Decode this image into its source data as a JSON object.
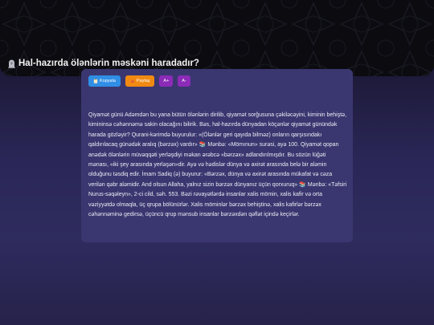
{
  "page": {
    "title": "Hal-hazırda ölənlərin məskəni haradadır?",
    "title_icon": "tombstone-icon"
  },
  "toolbar": {
    "copy_label": "Kopyala",
    "copy_icon": "clipboard-icon",
    "share_label": "Paylaş",
    "share_icon": "share-icon",
    "font_increase_label": "A+",
    "font_decrease_label": "A-"
  },
  "article": {
    "text": "Qiyamət günü Adəmdən bu yana bütün ölənlərin dirilib, qiyamət sorğusuna çəkiləcəyini, kiminin behiştə, kimininsə cəhənnəmə sakin olacağını bilirik. Bəs, hal-hazırda dünyadan köçənlər qiyamət günündək harada gözləyir? Qurani-kərimdə buyurulur: «(Ölənlər geri qayıda bilməz) onların qarşısındakı qaldırılacaq günədək aralıq (bərzəx) vardır» 📚 Mənbə: «Mömınun» surəsi, ayə 100. Qiyamət qopan anədək ölənlərin müvəqqəti yerləşdiyi məkan ərəbcə «bərzəx» adlandırılmışdır. Bu sözün lüğəti mənası, «iki şey arasında yerləşən»dir. Ayə və hədislər dünya və axirət arasında belə bir aləmin olduğunu təsdiq edir. İmam Sadiq (ə) buyurur: «Bərzəx, dünya və axirət arasında mükafat və cəza verilən qəbr aləmidir. And olsun Allaha, yalnız sizin bərzəx dünyanız üçün qorxuruq» 📚 Mənbə: «Təfsiri Nurus-səqəleyn», 2-ci cild, səh. 553. Bəzi rəvayətlərdə insanlar xalis mömin, xalis kafir və orta vəziyyətdə olmaqla, üç qrupa bölünürlər. Xalis möminlər bərzəx behiştinə, xalis kafirlər bərzəx cəhənnəminə gedirsə, üçüncü qrup mənsub insanlar bərzəxdən qəflət içində keçirlər."
  },
  "colors": {
    "copy": "#2f8ee6",
    "share": "#f08a12",
    "font_buttons": "#8c2bb8",
    "card": "#3a3770"
  }
}
